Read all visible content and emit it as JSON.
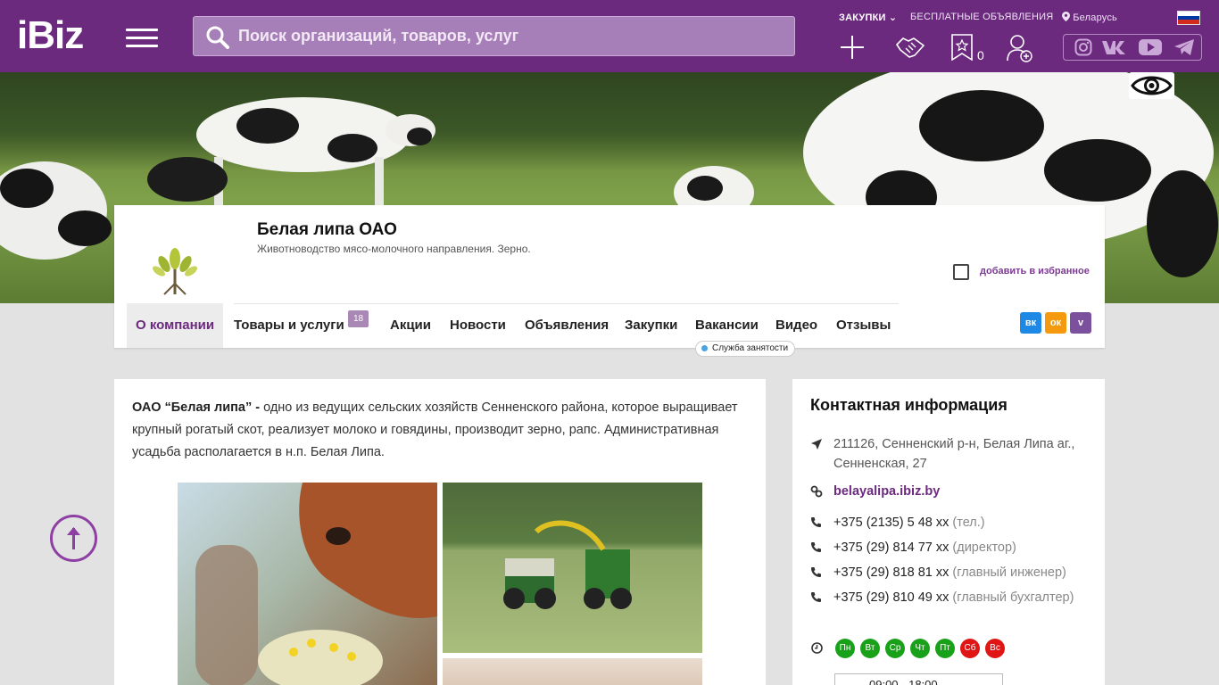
{
  "header": {
    "logo": "iBiz",
    "search_placeholder": "Поиск организаций, товаров, услуг",
    "links": {
      "purchases": "ЗАКУПКИ",
      "free_ads": "БЕСПЛАТНЫЕ ОБЪЯВЛЕНИЯ",
      "region": "Беларусь"
    },
    "favorites_count": "0",
    "icons": [
      "plus-icon",
      "handshake-icon",
      "star-bookmark-icon",
      "add-user-icon"
    ],
    "social_icons": [
      "instagram-icon",
      "vk-icon",
      "youtube-icon",
      "telegram-icon"
    ],
    "language_flag_colors": [
      "#ffffff",
      "#0039a6",
      "#d52b1e"
    ]
  },
  "company": {
    "name": "Белая липа ОАО",
    "description": "Животноводство мясо-молочного направления. Зерно.",
    "logo_text": "Белая липа",
    "add_favorite": "добавить в избранное"
  },
  "tabs": [
    {
      "label": "О компании",
      "active": true
    },
    {
      "label": "Товары и услуги",
      "badge": "18"
    },
    {
      "label": "Акции"
    },
    {
      "label": "Новости"
    },
    {
      "label": "Объявления"
    },
    {
      "label": "Закупки"
    },
    {
      "label": "Вакансии",
      "tooltip": "Служба занятости"
    },
    {
      "label": "Видео"
    },
    {
      "label": "Отзывы"
    }
  ],
  "share": [
    {
      "name": "vk-share-icon",
      "label": "вк",
      "color": "#1e88e5"
    },
    {
      "name": "ok-share-icon",
      "label": "ок",
      "color": "#f59a0e"
    },
    {
      "name": "viber-share-icon",
      "label": "v",
      "color": "#7b519d"
    }
  ],
  "about": {
    "lead": "ОАО “Белая липа” -",
    "text": " одно из ведущих сельских хозяйств Сенненского района, которое выращивает крупный рогатый скот, реализует молоко и говядины, производит  зерно, рапс. Административная усадьба располагается в н.п. Белая Липа."
  },
  "contacts": {
    "title": "Контактная информация",
    "address": "211126, Сенненский р-н, Белая Липа аг., Сенненская 27",
    "address_display": "211126, Сенненский р-н, Белая Липа аг., Сенненская, 27",
    "website": "belayalipa.ibiz.by",
    "phones": [
      {
        "number": "+375 (2135) 5 48 xx",
        "note": "(тел.)"
      },
      {
        "number": "+375 (29) 814 77 xx",
        "note": "(директор)"
      },
      {
        "number": "+375 (29) 818 81 xx",
        "note": "(главный инженер)"
      },
      {
        "number": "+375 (29) 810 49 xx",
        "note": "(главный бухгалтер)"
      }
    ],
    "days": [
      {
        "label": "Пн",
        "color": "#1aa11a"
      },
      {
        "label": "Вт",
        "color": "#1aa11a"
      },
      {
        "label": "Ср",
        "color": "#1aa11a"
      },
      {
        "label": "Чт",
        "color": "#1aa11a"
      },
      {
        "label": "Пт",
        "color": "#1aa11a"
      },
      {
        "label": "Сб",
        "color": "#e01515"
      },
      {
        "label": "Вс",
        "color": "#e01515"
      }
    ],
    "hours": "09:00 - 18:00"
  }
}
